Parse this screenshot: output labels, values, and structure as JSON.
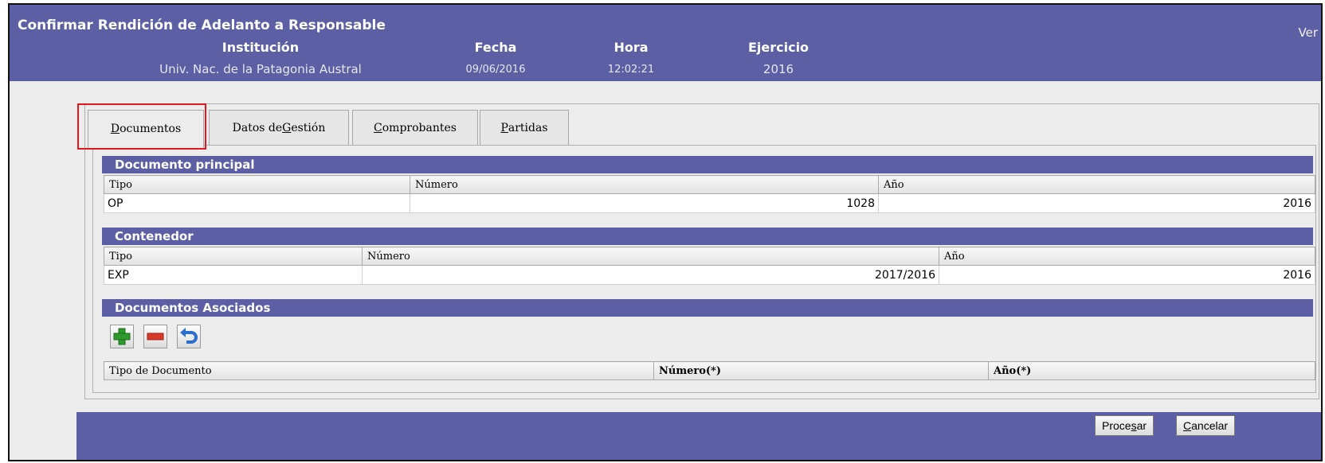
{
  "header": {
    "title": "Confirmar Rendición de Adelanto a Responsable",
    "version_label": "Ver",
    "columns": [
      {
        "label": "Institución",
        "value": "Univ. Nac. de la Patagonia Austral"
      },
      {
        "label": "Fecha",
        "value": "09/06/2016"
      },
      {
        "label": "Hora",
        "value": "12:02:21"
      },
      {
        "label": "Ejercicio",
        "value": "2016"
      }
    ]
  },
  "tabs": [
    {
      "pre": "",
      "key": "D",
      "post": "ocumentos",
      "active": true
    },
    {
      "pre": "Datos de ",
      "key": "G",
      "post": "estión",
      "active": false
    },
    {
      "pre": "",
      "key": "C",
      "post": "omprobantes",
      "active": false
    },
    {
      "pre": "",
      "key": "P",
      "post": "artidas",
      "active": false
    }
  ],
  "documento_principal": {
    "title": "Documento principal",
    "headers": [
      "Tipo",
      "Número",
      "Año"
    ],
    "row": {
      "tipo": "OP",
      "numero": "1028",
      "anio": "2016"
    }
  },
  "contenedor": {
    "title": "Contenedor",
    "headers": [
      "Tipo",
      "Número",
      "Año"
    ],
    "row": {
      "tipo": "EXP",
      "numero": "2017/2016",
      "anio": "2016"
    }
  },
  "documentos_asociados": {
    "title": "Documentos Asociados",
    "toolbar": [
      "add-icon",
      "remove-icon",
      "undo-icon"
    ],
    "headers": [
      "Tipo de Documento",
      "Número(*)",
      "Año(*)"
    ]
  },
  "footer": {
    "procesar": {
      "pre": "Proce",
      "key": "s",
      "post": "ar"
    },
    "cancelar": {
      "pre": "",
      "key": "C",
      "post": "ancelar"
    }
  },
  "colors": {
    "header_bg": "#5c5fa3",
    "highlight": "#e0191c",
    "add": "#2e9a2e",
    "remove": "#d83a2a",
    "undo": "#2a6fd0"
  }
}
